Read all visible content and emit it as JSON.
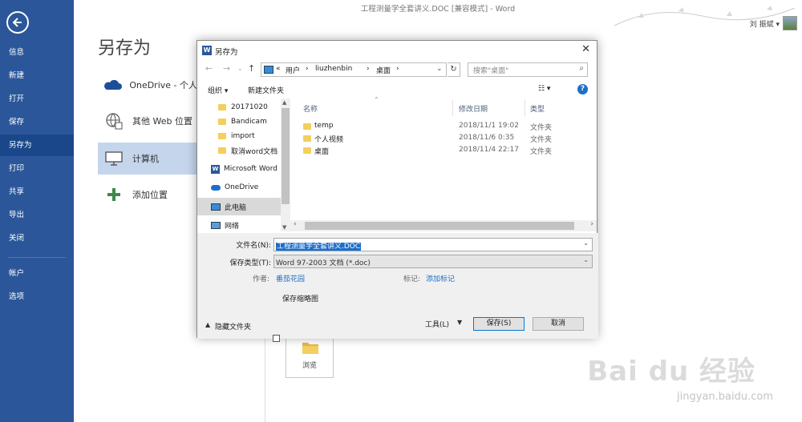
{
  "window": {
    "title": "工程测量学全套讲义.DOC [兼容模式] - Word",
    "user": "刘 振斌 ▾"
  },
  "nav": {
    "items": [
      "信息",
      "新建",
      "打开",
      "保存",
      "另存为",
      "打印",
      "共享",
      "导出",
      "关闭",
      "帐户",
      "选项"
    ],
    "active": "另存为"
  },
  "main": {
    "title": "另存为",
    "places": [
      "OneDrive - 个人",
      "其他 Web 位置",
      "计算机",
      "添加位置"
    ],
    "browse_label": "浏览"
  },
  "dialog": {
    "title": "另存为",
    "address": [
      "«",
      "用户",
      "›",
      "liuzhenbin",
      "›",
      "桌面",
      "›"
    ],
    "search_placeholder": "搜索\"桌面\"",
    "toolbar": {
      "organize": "组织 ▾",
      "new_folder": "新建文件夹",
      "view": "☷ ▾",
      "help": "?"
    },
    "tree": [
      "20171020",
      "Bandicam",
      "import",
      "取消word文档",
      "Microsoft Word",
      "OneDrive",
      "此电脑",
      "网络"
    ],
    "columns": [
      "名称",
      "修改日期",
      "类型"
    ],
    "files": [
      {
        "name": "temp",
        "date": "2018/11/1 19:02",
        "type": "文件夹"
      },
      {
        "name": "个人视频",
        "date": "2018/11/6 0:35",
        "type": "文件夹"
      },
      {
        "name": "桌面",
        "date": "2018/11/4 22:17",
        "type": "文件夹"
      }
    ],
    "form": {
      "filename_label": "文件名(N):",
      "filename": "工程测量学全套讲义.DOC",
      "type_label": "保存类型(T):",
      "type": "Word 97-2003 文档 (*.doc)",
      "author_label": "作者:",
      "author": "番茄花园",
      "tags_label": "标记:",
      "tags": "添加标记",
      "thumbnail": "保存缩略图",
      "hide_folders": "隐藏文件夹",
      "tools": "工具(L)",
      "save": "保存(S)",
      "cancel": "取消"
    }
  },
  "watermark": {
    "logo": "Bai du 经验",
    "url": "jingyan.baidu.com"
  },
  "colors": {
    "accent": "#2b579a",
    "selection": "#1c6ec9",
    "folder": "#f4cf5e"
  }
}
